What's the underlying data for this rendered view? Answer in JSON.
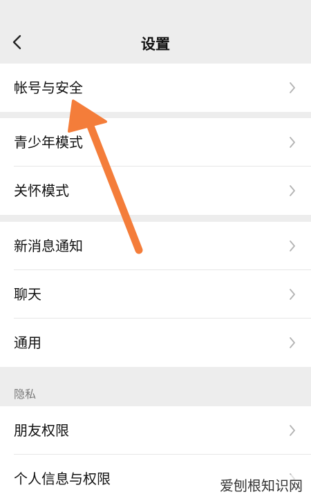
{
  "header": {
    "title": "设置"
  },
  "groups": [
    {
      "items": [
        {
          "label": "帐号与安全"
        }
      ]
    },
    {
      "items": [
        {
          "label": "青少年模式"
        },
        {
          "label": "关怀模式"
        }
      ]
    },
    {
      "items": [
        {
          "label": "新消息通知"
        },
        {
          "label": "聊天"
        },
        {
          "label": "通用"
        }
      ]
    },
    {
      "section_label": "隐私",
      "items": [
        {
          "label": "朋友权限"
        },
        {
          "label": "个人信息与权限"
        }
      ]
    }
  ],
  "watermark": "爱刨根知识网",
  "icons": {
    "back": "chevron-left-icon",
    "row": "chevron-right-icon"
  },
  "colors": {
    "background": "#ededed",
    "annotation_arrow": "#f47d3a"
  }
}
